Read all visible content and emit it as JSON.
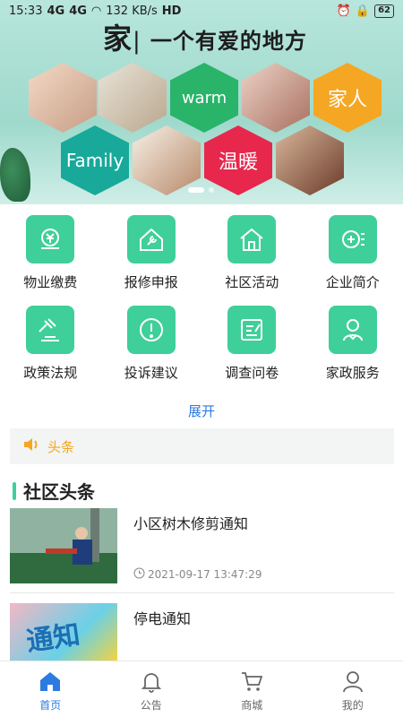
{
  "status_bar": {
    "time": "15:33",
    "signal_a": "4G",
    "signal_b": "4G",
    "speed": "132 KB/s",
    "hd": "HD",
    "battery": "62"
  },
  "banner": {
    "title_big": "家",
    "title_rest": "一个有爱的地方",
    "hex_words": [
      "warm",
      "家人",
      "Family",
      "温暖"
    ]
  },
  "services": [
    {
      "label": "物业缴费",
      "icon": "payment-icon"
    },
    {
      "label": "报修申报",
      "icon": "repair-icon"
    },
    {
      "label": "社区活动",
      "icon": "house-icon"
    },
    {
      "label": "企业简介",
      "icon": "enterprise-icon"
    },
    {
      "label": "政策法规",
      "icon": "gavel-icon"
    },
    {
      "label": "投诉建议",
      "icon": "alert-icon"
    },
    {
      "label": "调查问卷",
      "icon": "survey-icon"
    },
    {
      "label": "家政服务",
      "icon": "housekeeper-icon"
    }
  ],
  "expand_label": "展开",
  "notice": {
    "label": "头条",
    "icon": "speaker-icon"
  },
  "section_title": "社区头条",
  "news": [
    {
      "title": "小区树木修剪通知",
      "time": "2021-09-17 13:47:29"
    },
    {
      "title": "停电通知",
      "thumb_text": "通知"
    }
  ],
  "tabs": [
    {
      "label": "首页",
      "icon": "home-icon",
      "active": true
    },
    {
      "label": "公告",
      "icon": "bell-icon",
      "active": false
    },
    {
      "label": "商城",
      "icon": "cart-icon",
      "active": false
    },
    {
      "label": "我的",
      "icon": "user-icon",
      "active": false
    }
  ],
  "colors": {
    "accent": "#3fcf9a",
    "link": "#2b7be0",
    "notice": "#f5a623"
  }
}
